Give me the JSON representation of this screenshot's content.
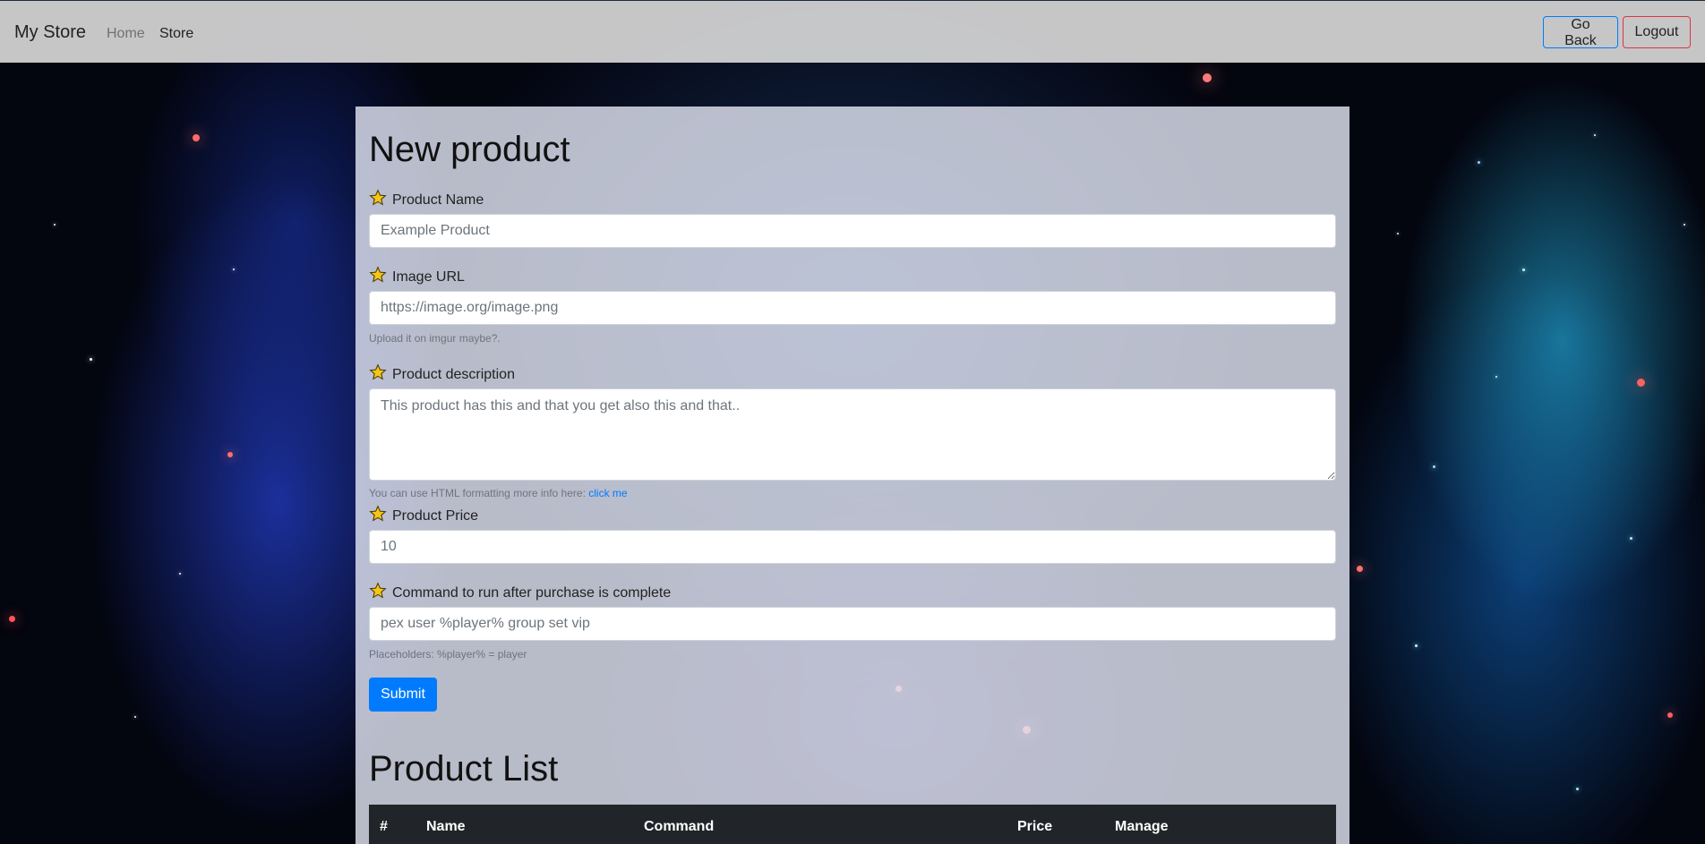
{
  "navbar": {
    "brand": "My Store",
    "links": [
      "Home",
      "Store"
    ],
    "go_back": "Go Back",
    "logout": "Logout"
  },
  "form": {
    "title": "New product",
    "product_name": {
      "label": "Product Name",
      "placeholder": "Example Product"
    },
    "image_url": {
      "label": "Image URL",
      "placeholder": "https://image.org/image.png",
      "help": "Upload it on imgur maybe?."
    },
    "description": {
      "label": "Product description",
      "placeholder": "This product has this and that you get also this and that..",
      "help": "You can use HTML formatting more info here:",
      "help_link": "click me"
    },
    "price": {
      "label": "Product Price",
      "placeholder": "10"
    },
    "command": {
      "label": "Command to run after purchase is complete",
      "placeholder": "pex user %player% group set vip",
      "help": "Placeholders: %player% = player"
    },
    "submit": "Submit"
  },
  "product_list": {
    "title": "Product List",
    "columns": [
      "#",
      "Name",
      "Command",
      "Price",
      "Manage"
    ]
  },
  "colors": {
    "primary": "#007bff",
    "danger": "#dc3545",
    "table_header": "#212529",
    "star_icon": "#f5c518"
  }
}
